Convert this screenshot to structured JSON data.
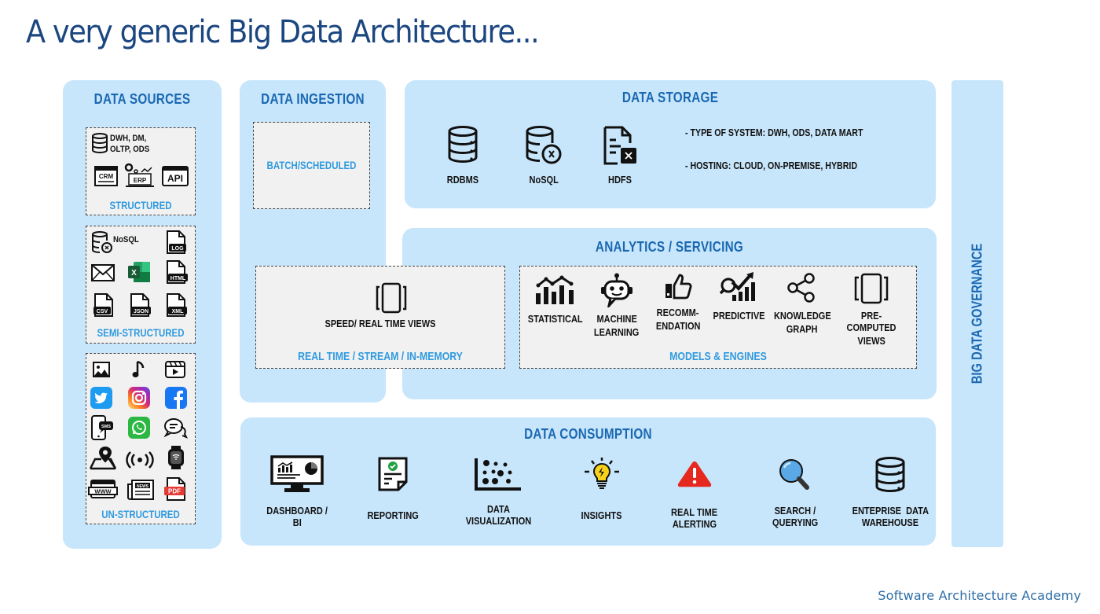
{
  "title": "A very generic Big Data Architecture...",
  "footer": "Software Architecture Academy",
  "colors": {
    "panel_bg": "#c8e6fb",
    "heading": "#1a68b2",
    "subheading": "#2e9ae0",
    "title": "#1b4680",
    "dashed_box_bg": "#f1f1f1"
  },
  "data_sources": {
    "heading": "DATA SOURCES",
    "structured": {
      "label": "STRUCTURED",
      "db_text_line1": "DWH, DM,",
      "db_text_line2": "OLTP, ODS",
      "icons": [
        "database-icon",
        "crm-icon",
        "erp-icon",
        "api-icon"
      ],
      "crm": "CRM",
      "erp": "ERP",
      "api": "API"
    },
    "semi_structured": {
      "label": "SEMI-STRUCTURED",
      "nosql": "NoSQL",
      "icons": [
        "nosql-database-icon",
        "log-file-icon",
        "email-icon",
        "excel-icon",
        "html-file-icon",
        "csv-file-icon",
        "json-file-icon",
        "xml-file-icon"
      ],
      "log": "LOG",
      "html": "HTML",
      "csv": "CSV",
      "json": "JSON",
      "xml": "XML",
      "excel": "X"
    },
    "unstructured": {
      "label": "UN-STRUCTURED",
      "icons": [
        "image-icon",
        "music-icon",
        "video-icon",
        "twitter-icon",
        "instagram-icon",
        "facebook-icon",
        "sms-icon",
        "whatsapp-icon",
        "chat-icon",
        "map-pin-icon",
        "broadcast-icon",
        "smartwatch-icon",
        "www-icon",
        "news-icon",
        "pdf-icon"
      ],
      "sms": "SMS",
      "www": "WWW",
      "news": "NEWS",
      "pdf": "PDF"
    }
  },
  "data_ingestion": {
    "heading": "DATA INGESTION",
    "batch_label": "BATCH/SCHEDULED"
  },
  "realtime": {
    "label": "REAL TIME / STREAM / IN-MEMORY",
    "view_label": "SPEED/ REAL TIME VIEWS"
  },
  "data_storage": {
    "heading": "DATA STORAGE",
    "items": [
      {
        "label": "RDBMS",
        "icon": "database-icon"
      },
      {
        "label": "NoSQL",
        "icon": "nosql-database-icon"
      },
      {
        "label": "HDFS",
        "icon": "hdfs-file-icon"
      }
    ],
    "notes": [
      "- TYPE OF SYSTEM: DWH, ODS, DATA MART",
      "- HOSTING:  CLOUD, ON-PREMISE,  HYBRID"
    ]
  },
  "analytics": {
    "heading": "ANALYTICS / SERVICING",
    "models_label": "MODELS & ENGINES",
    "items": [
      {
        "line1": "STATISTICAL",
        "line2": "",
        "icon": "bar-chart-icon"
      },
      {
        "line1": "MACHINE",
        "line2": "LEARNING",
        "icon": "robot-icon"
      },
      {
        "line1": "RECOMM-",
        "line2": "ENDATION",
        "icon": "thumbs-up-icon"
      },
      {
        "line1": "PREDICTIVE",
        "line2": "",
        "icon": "predictive-chart-icon"
      },
      {
        "line1": "KNOWLEDGE",
        "line2": "GRAPH",
        "icon": "share-graph-icon"
      },
      {
        "line1": "PRE-COMPUTED",
        "line2": "VIEWS",
        "icon": "tablet-views-icon"
      }
    ]
  },
  "data_consumption": {
    "heading": "DATA CONSUMPTION",
    "items": [
      {
        "line1": "DASHBOARD /",
        "line2": "BI",
        "icon": "dashboard-monitor-icon"
      },
      {
        "line1": "REPORTING",
        "line2": "",
        "icon": "report-icon"
      },
      {
        "line1": "DATA",
        "line2": "VISUALIZATION",
        "icon": "scatter-plot-icon"
      },
      {
        "line1": "INSIGHTS",
        "line2": "",
        "icon": "lightbulb-icon"
      },
      {
        "line1": "REAL TIME",
        "line2": "ALERTING",
        "icon": "warning-icon"
      },
      {
        "line1": "SEARCH /",
        "line2": "QUERYING",
        "icon": "magnifier-icon"
      },
      {
        "line1": "ENTEPRISE  DATA",
        "line2": "WAREHOUSE",
        "icon": "database-icon"
      }
    ]
  },
  "governance": {
    "label": "BIG DATA GOVERNANCE"
  }
}
